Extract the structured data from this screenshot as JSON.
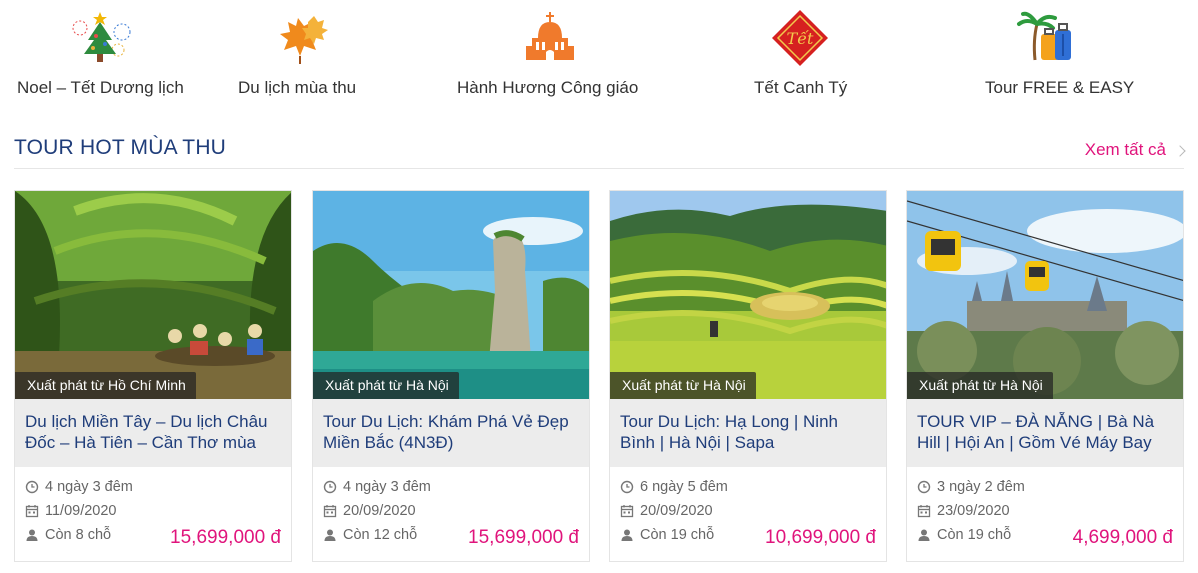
{
  "categories": [
    {
      "label": "Noel – Tết Dương lịch",
      "icon": "christmas-tree-icon"
    },
    {
      "label": "Du lịch mùa thu",
      "icon": "autumn-leaves-icon"
    },
    {
      "label": "Hành Hương Công giáo",
      "icon": "church-icon"
    },
    {
      "label": "Tết Canh Tý",
      "icon": "tet-emblem-icon"
    },
    {
      "label": "Tour FREE & EASY",
      "icon": "luggage-palm-icon"
    }
  ],
  "section": {
    "title": "TOUR HOT MÙA THU",
    "see_all": "Xem tất cả"
  },
  "tours": [
    {
      "origin": "Xuất phát từ Hồ Chí Minh",
      "title": "Du lịch Miền Tây – Du lịch Châu Đốc – Hà Tiên – Cần Thơ mùa",
      "duration": "4 ngày 3 đêm",
      "date": "11/09/2020",
      "seats": "Còn 8 chỗ",
      "price": "15,699,000 đ"
    },
    {
      "origin": "Xuất phát từ Hà Nội",
      "title": "Tour Du Lịch: Khám Phá Vẻ Đẹp Miền Bắc (4N3Đ)",
      "duration": "4 ngày 3 đêm",
      "date": "20/09/2020",
      "seats": "Còn 12 chỗ",
      "price": "15,699,000 đ"
    },
    {
      "origin": "Xuất phát từ Hà Nội",
      "title": "Tour Du Lịch: Hạ Long | Ninh Bình | Hà Nội | Sapa",
      "duration": "6 ngày 5 đêm",
      "date": "20/09/2020",
      "seats": "Còn 19 chỗ",
      "price": "10,699,000 đ"
    },
    {
      "origin": "Xuất phát từ Hà Nội",
      "title": "TOUR VIP – ĐÀ NẴNG | Bà Nà Hill | Hội An | Gồm Vé Máy Bay",
      "duration": "3 ngày 2 đêm",
      "date": "23/09/2020",
      "seats": "Còn 19 chỗ",
      "price": "4,699,000 đ"
    }
  ],
  "colors": {
    "heading": "#1f3d7a",
    "accent": "#e0147c",
    "title_bg": "#ececec"
  }
}
